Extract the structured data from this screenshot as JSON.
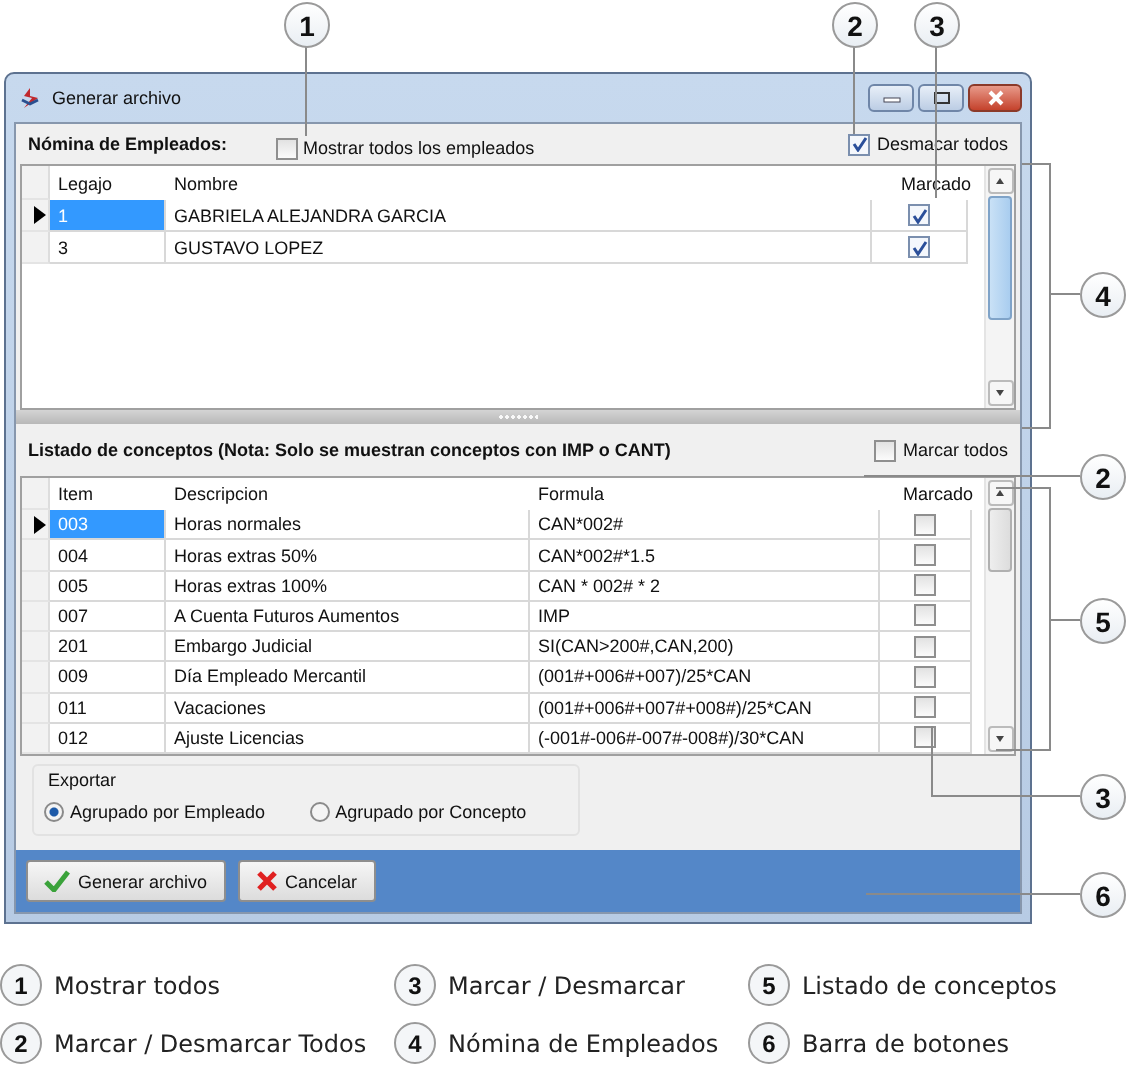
{
  "window": {
    "title": "Generar archivo"
  },
  "employees": {
    "title": "Nómina de Empleados:",
    "show_all": {
      "label": "Mostrar todos los empleados",
      "checked": false
    },
    "toggle_all": {
      "label": "Desmacar todos",
      "checked": true
    },
    "columns": [
      "Legajo",
      "Nombre",
      "Marcado"
    ],
    "rows": [
      {
        "legajo": "1",
        "nombre": "GABRIELA ALEJANDRA GARCIA",
        "checked": true,
        "selected": true
      },
      {
        "legajo": "3",
        "nombre": "GUSTAVO LOPEZ",
        "checked": true,
        "selected": false
      }
    ]
  },
  "concepts": {
    "title": "Listado de conceptos (Nota: Solo se muestran conceptos con IMP o CANT)",
    "toggle_all": {
      "label": "Marcar todos",
      "checked": false
    },
    "columns": [
      "Item",
      "Descripcion",
      "Formula",
      "Marcado"
    ],
    "rows": [
      {
        "item": "003",
        "descripcion": "Horas normales",
        "formula": "CAN*002#",
        "checked": false,
        "selected": true
      },
      {
        "item": "004",
        "descripcion": "Horas extras 50%",
        "formula": "CAN*002#*1.5",
        "checked": false,
        "selected": false
      },
      {
        "item": "005",
        "descripcion": "Horas extras 100%",
        "formula": "CAN * 002# * 2",
        "checked": false,
        "selected": false
      },
      {
        "item": "007",
        "descripcion": "A Cuenta Futuros Aumentos",
        "formula": "IMP",
        "checked": false,
        "selected": false
      },
      {
        "item": "201",
        "descripcion": "Embargo Judicial",
        "formula": "SI(CAN>200#,CAN,200)",
        "checked": false,
        "selected": false
      },
      {
        "item": "009",
        "descripcion": "Día Empleado Mercantil",
        "formula": "(001#+006#+007)/25*CAN",
        "checked": false,
        "selected": false
      },
      {
        "item": "011",
        "descripcion": "Vacaciones",
        "formula": "(001#+006#+007#+008#)/25*CAN",
        "checked": false,
        "selected": false
      },
      {
        "item": "012",
        "descripcion": "Ajuste Licencias",
        "formula": "(-001#-006#-007#-008#)/30*CAN",
        "checked": false,
        "selected": false
      }
    ]
  },
  "export": {
    "title": "Exportar",
    "options": [
      {
        "label": "Agrupado por Empleado",
        "selected": true
      },
      {
        "label": "Agrupado por Concepto",
        "selected": false
      }
    ]
  },
  "buttons": [
    {
      "label": "Generar archivo",
      "kind": "confirm"
    },
    {
      "label": "Cancelar",
      "kind": "cancel"
    }
  ],
  "callouts": [
    "1",
    "2",
    "3",
    "4",
    "2",
    "5",
    "3",
    "6"
  ],
  "legend": [
    {
      "number": "1",
      "label": "Mostrar todos"
    },
    {
      "number": "2",
      "label": "Marcar / Desmarcar Todos"
    },
    {
      "number": "3",
      "label": "Marcar / Desmarcar"
    },
    {
      "number": "4",
      "label": "Nómina de Empleados"
    },
    {
      "number": "5",
      "label": "Listado de conceptos"
    },
    {
      "number": "6",
      "label": "Barra de botones"
    }
  ]
}
